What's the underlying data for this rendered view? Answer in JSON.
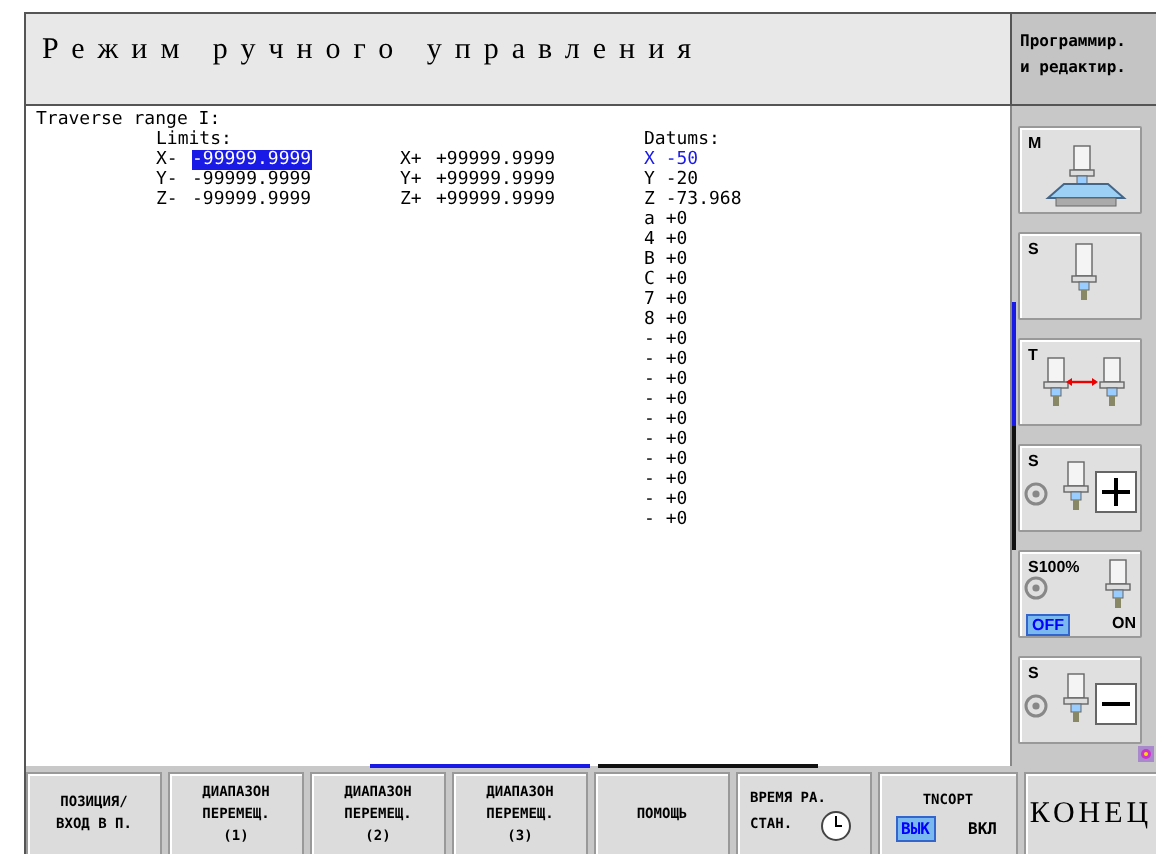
{
  "header": {
    "mode_title": "Режим ручного управления",
    "other_mode_lines": [
      "Программир.",
      "и редактир."
    ]
  },
  "content": {
    "section_title": "Traverse range I:",
    "limits_label": "Limits:",
    "datums_label": "Datums:",
    "limits": [
      {
        "minus_axis": "X-",
        "minus_value": "-99999.9999",
        "plus_axis": "X+",
        "plus_value": "+99999.9999",
        "selected": true
      },
      {
        "minus_axis": "Y-",
        "minus_value": "-99999.9999",
        "plus_axis": "Y+",
        "plus_value": "+99999.9999",
        "selected": false
      },
      {
        "minus_axis": "Z-",
        "minus_value": "-99999.9999",
        "plus_axis": "Z+",
        "plus_value": "+99999.9999",
        "selected": false
      }
    ],
    "datums": [
      {
        "axis": "X",
        "value": "-50",
        "selected": true
      },
      {
        "axis": "Y",
        "value": "-20",
        "selected": false
      },
      {
        "axis": "Z",
        "value": "-73.968",
        "selected": false
      },
      {
        "axis": "a",
        "value": "+0",
        "selected": false
      },
      {
        "axis": "4",
        "value": "+0",
        "selected": false
      },
      {
        "axis": "B",
        "value": "+0",
        "selected": false
      },
      {
        "axis": "C",
        "value": "+0",
        "selected": false
      },
      {
        "axis": "7",
        "value": "+0",
        "selected": false
      },
      {
        "axis": "8",
        "value": "+0",
        "selected": false
      },
      {
        "axis": "-",
        "value": "+0",
        "selected": false
      },
      {
        "axis": "-",
        "value": "+0",
        "selected": false
      },
      {
        "axis": "-",
        "value": "+0",
        "selected": false
      },
      {
        "axis": "-",
        "value": "+0",
        "selected": false
      },
      {
        "axis": "-",
        "value": "+0",
        "selected": false
      },
      {
        "axis": "-",
        "value": "+0",
        "selected": false
      },
      {
        "axis": "-",
        "value": "+0",
        "selected": false
      },
      {
        "axis": "-",
        "value": "+0",
        "selected": false
      },
      {
        "axis": "-",
        "value": "+0",
        "selected": false
      },
      {
        "axis": "-",
        "value": "+0",
        "selected": false
      }
    ]
  },
  "side_softkeys": [
    {
      "kind": "machine",
      "label": "M"
    },
    {
      "kind": "spindle",
      "label": "S"
    },
    {
      "kind": "tool_change",
      "label": "T"
    },
    {
      "kind": "spindle_plus",
      "label": "S"
    },
    {
      "kind": "override",
      "label": "S100%",
      "options": [
        {
          "label": "OFF",
          "selected": true
        },
        {
          "label": "ON",
          "selected": false
        }
      ]
    },
    {
      "kind": "spindle_minus",
      "label": "S"
    }
  ],
  "side_pages": [
    {
      "selected": true
    },
    {
      "selected": false
    }
  ],
  "softkey_pages": [
    {
      "selected": true
    },
    {
      "selected": false
    }
  ],
  "softkeys": [
    {
      "kind": "text",
      "lines": [
        "ПОЗИЦИЯ/",
        "ВХОД В П."
      ]
    },
    {
      "kind": "text",
      "lines": [
        "ДИАПАЗОН",
        "ПЕРЕМЕЩ.",
        "(1)"
      ]
    },
    {
      "kind": "text",
      "lines": [
        "ДИАПАЗОН",
        "ПЕРЕМЕЩ.",
        "(2)"
      ]
    },
    {
      "kind": "text",
      "lines": [
        "ДИАПАЗОН",
        "ПЕРЕМЕЩ.",
        "(3)"
      ]
    },
    {
      "kind": "text",
      "lines": [
        "ПОМОЩЬ"
      ]
    },
    {
      "kind": "clock",
      "lines": [
        "ВРЕМЯ РА.",
        "СТАН."
      ]
    },
    {
      "kind": "toggle",
      "lines": [
        "TNCOPT"
      ],
      "options": [
        {
          "label": "ВЫК",
          "selected": true
        },
        {
          "label": "ВКЛ",
          "selected": false
        }
      ]
    },
    {
      "kind": "end",
      "lines": [
        "КОНЕЦ"
      ]
    }
  ]
}
